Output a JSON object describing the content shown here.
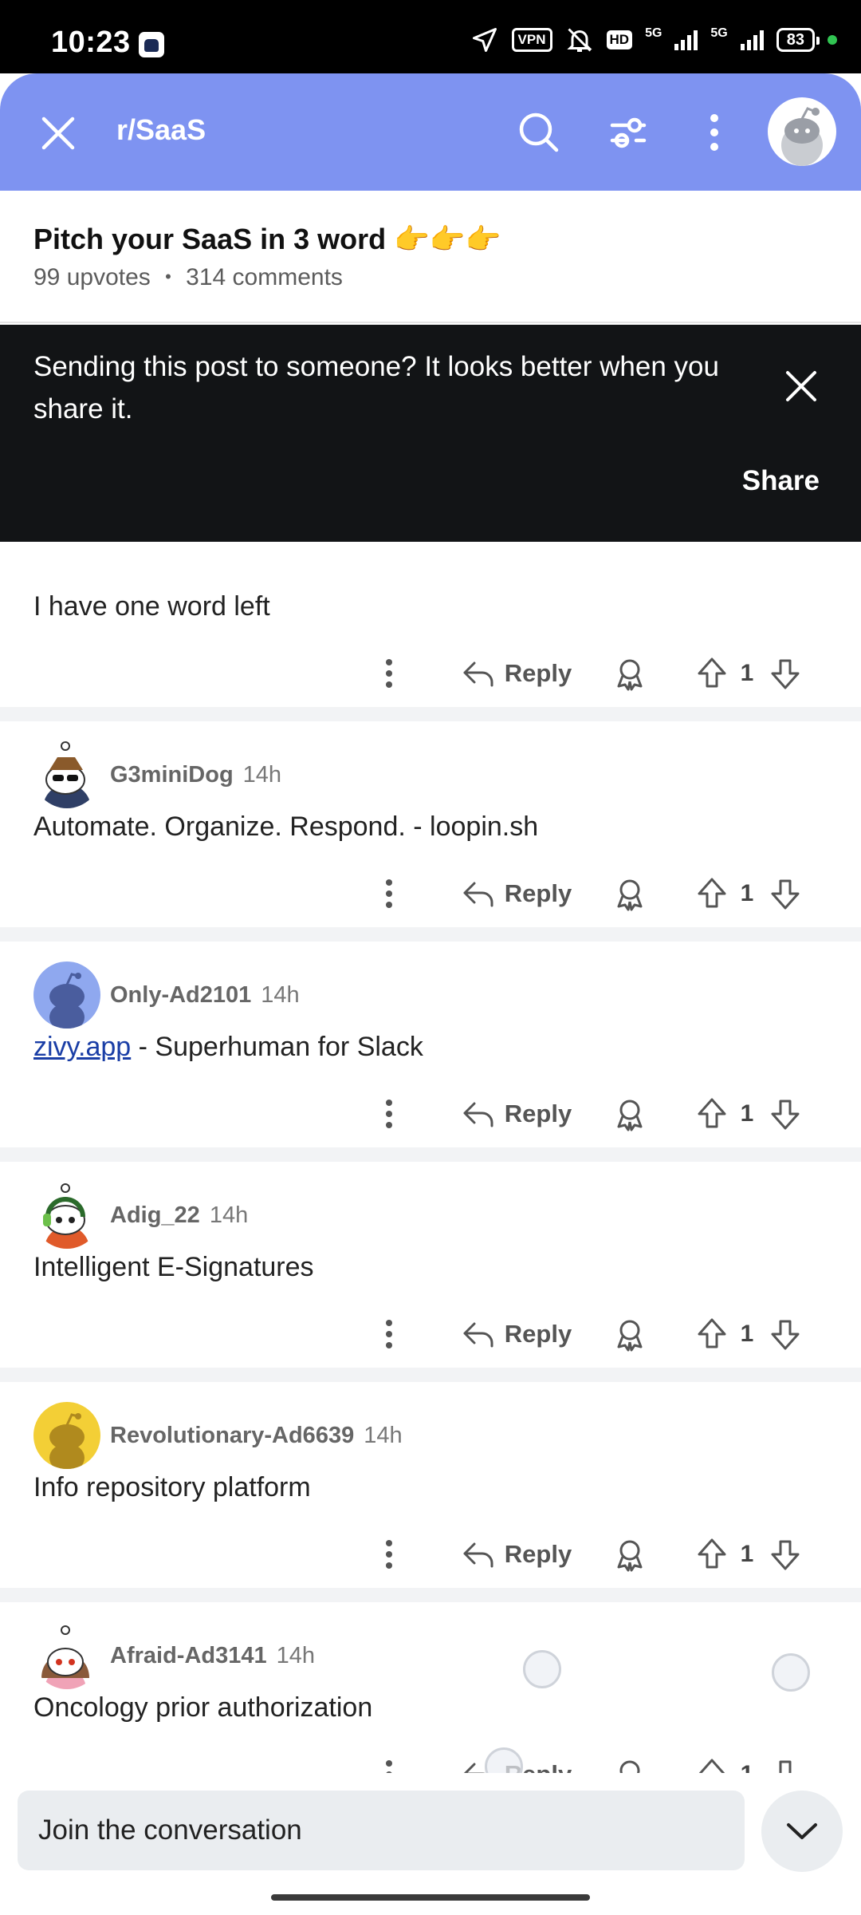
{
  "status_bar": {
    "time": "10:23",
    "vpn": "VPN",
    "hd": "HD",
    "net1": "5G",
    "net2": "5G",
    "battery": "83"
  },
  "header": {
    "subreddit": "r/SaaS",
    "icons": [
      "close-icon",
      "search-icon",
      "filter-icon",
      "more-vertical-icon",
      "avatar"
    ],
    "color": "#7e93f1"
  },
  "post": {
    "title": "Pitch your SaaS in 3 word 👉👉👉",
    "upvotes": "99 upvotes",
    "separator": "•",
    "comments": "314 comments"
  },
  "snackbar": {
    "message": "Sending this post to someone? It looks better when you share it.",
    "action": "Share"
  },
  "comments": [
    {
      "user": "",
      "time": "",
      "body": "I have one word left",
      "votes": "1",
      "reply_label": "Reply"
    },
    {
      "user": "G3miniDog",
      "time": "14h",
      "body": "Automate. Organize. Respond. - loopin.sh",
      "votes": "1",
      "reply_label": "Reply",
      "avatar_color": "#ffffff"
    },
    {
      "user": "Only-Ad2101",
      "time": "14h",
      "link": "zivy.app",
      "body": " - Superhuman for Slack",
      "votes": "1",
      "reply_label": "Reply",
      "avatar_color": "#8fa8ef"
    },
    {
      "user": "Adig_22",
      "time": "14h",
      "body": "Intelligent E-Signatures",
      "votes": "1",
      "reply_label": "Reply",
      "avatar_color": "#ffffff"
    },
    {
      "user": "Revolutionary-Ad6639",
      "time": "14h",
      "body": "Info repository platform",
      "votes": "1",
      "reply_label": "Reply",
      "avatar_color": "#f3cf36"
    },
    {
      "user": "Afraid-Ad3141",
      "time": "14h",
      "body": "Oncology prior authorization",
      "votes": "1",
      "reply_label": "Reply",
      "avatar_color": "#ffffff"
    }
  ],
  "bottom": {
    "placeholder": "Join the conversation"
  }
}
